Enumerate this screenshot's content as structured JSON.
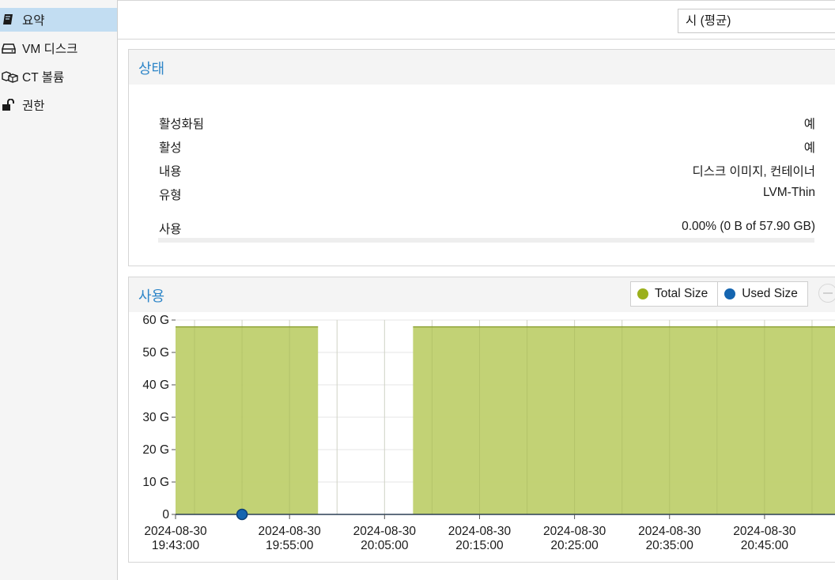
{
  "sidebar": {
    "items": [
      {
        "label": "요약",
        "icon": "book-icon",
        "active": true
      },
      {
        "label": "VM 디스크",
        "icon": "hdd-icon",
        "active": false
      },
      {
        "label": "CT 볼륨",
        "icon": "cubes-icon",
        "active": false
      },
      {
        "label": "권한",
        "icon": "unlock-icon",
        "active": false
      }
    ]
  },
  "toolbar": {
    "timeframe": "시 (평균)"
  },
  "status": {
    "title": "상태",
    "rows": [
      {
        "key": "활성화됨",
        "value": "예"
      },
      {
        "key": "활성",
        "value": "예"
      },
      {
        "key": "내용",
        "value": "디스크 이미지, 컨테이너"
      },
      {
        "key": "유형",
        "value": "LVM-Thin"
      }
    ],
    "usage": {
      "key": "사용",
      "value": "0.00% (0 B of 57.90 GB)",
      "fraction": 0.0
    }
  },
  "usage_chart": {
    "title": "사용",
    "legend": [
      {
        "label": "Total Size",
        "color": "#9bb01c"
      },
      {
        "label": "Used Size",
        "color": "#1565b0"
      }
    ]
  },
  "colors": {
    "accent": "#2f86c8",
    "total_fill": "#bfd06e",
    "total_line": "#8fa33a",
    "used": "#1565b0"
  },
  "chart_data": {
    "type": "area",
    "title": "사용",
    "xlabel": "",
    "ylabel": "",
    "ylim": [
      0,
      60
    ],
    "yticks": [
      0,
      10,
      20,
      30,
      40,
      50,
      60
    ],
    "ytick_labels": [
      "0",
      "10 G",
      "20 G",
      "30 G",
      "40 G",
      "50 G",
      "60 G"
    ],
    "xlim_minutes": [
      0,
      69.5
    ],
    "xticks": [
      {
        "label": [
          "2024-08-30",
          "19:43:00"
        ],
        "t": 0
      },
      {
        "label": [
          "2024-08-30",
          "19:55:00"
        ],
        "t": 12
      },
      {
        "label": [
          "2024-08-30",
          "20:05:00"
        ],
        "t": 22
      },
      {
        "label": [
          "2024-08-30",
          "20:15:00"
        ],
        "t": 32
      },
      {
        "label": [
          "2024-08-30",
          "20:25:00"
        ],
        "t": 42
      },
      {
        "label": [
          "2024-08-30",
          "20:35:00"
        ],
        "t": 52
      },
      {
        "label": [
          "2024-08-30",
          "20:45:00"
        ],
        "t": 62
      }
    ],
    "grid": true,
    "legend_position": "top-right",
    "series": [
      {
        "name": "Total Size",
        "segments": [
          {
            "start": 0,
            "end": 15,
            "value": 57.9
          },
          {
            "start": 25,
            "end": 69.5,
            "value": 57.9
          }
        ]
      },
      {
        "name": "Used Size",
        "points": [
          {
            "t": 7,
            "value": 0
          }
        ]
      }
    ]
  }
}
